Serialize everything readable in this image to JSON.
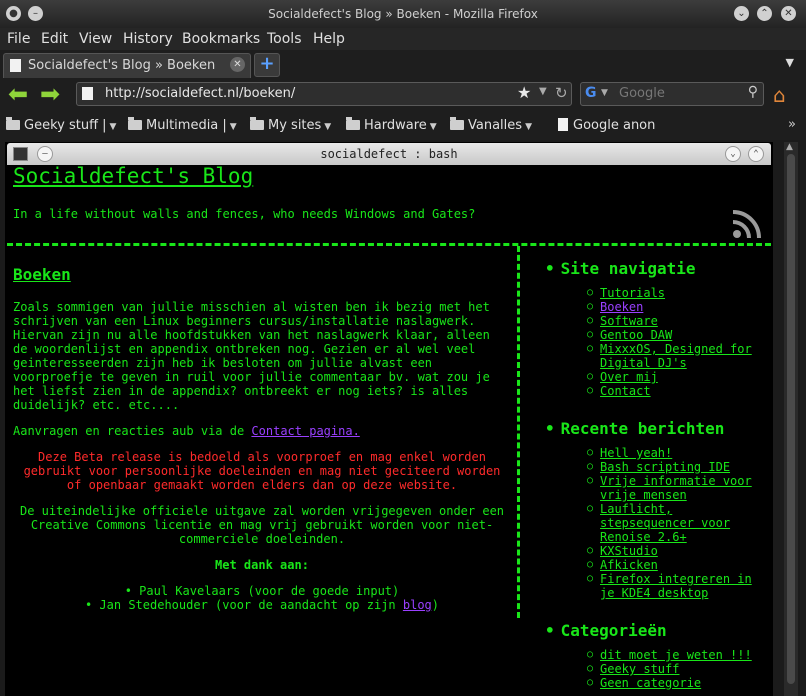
{
  "window": {
    "title": "Socialdefect's Blog » Boeken - Mozilla Firefox"
  },
  "menu": [
    "File",
    "Edit",
    "View",
    "History",
    "Bookmarks",
    "Tools",
    "Help"
  ],
  "tab": {
    "label": "Socialdefect's Blog » Boeken",
    "new_tab": "+"
  },
  "nav": {
    "url": "http://socialdefect.nl/boeken/",
    "search_placeholder": "Google"
  },
  "bookmarks": [
    "Geeky stuff |",
    "Multimedia |",
    "My sites",
    "Hardware",
    "Vanalles",
    "Google anon"
  ],
  "terminal": {
    "title": "socialdefect : bash"
  },
  "blog": {
    "title": "Socialdefect's Blog",
    "tagline": "In a life without walls and fences, who needs Windows and Gates?"
  },
  "content": {
    "heading": "Boeken",
    "intro": "Zoals sommigen van jullie misschien al wisten ben ik bezig met het schrijven van een Linux beginners cursus/installatie naslagwerk. Hiervan zijn nu alle hoofdstukken van het naslagwerk klaar, alleen de woordenlijst en appendix ontbreken nog. Gezien er al wel veel geinteresseerden zijn heb ik besloten om jullie alvast een voorproefje te geven in ruil voor jullie commentaar bv. wat zou je het liefst zien in de appendix? ontbreekt er nog iets? is alles duidelijk? etc. etc....",
    "request_prefix": "Aanvragen en reacties aub via de ",
    "request_link": "Contact pagina.",
    "beta_notice": "Deze Beta release is bedoeld als voorproef en mag enkel worden gebruikt voor persoonlijke doeleinden en mag niet geciteerd worden of  openbaar gemaakt worden elders dan op deze website.",
    "license": "De uiteindelijke officiele uitgave zal worden vrijgegeven onder een Creative Commons licentie en mag vrij gebruikt worden voor niet-commerciele doeleinden.",
    "thanks_heading": "Met dank aan:",
    "thanks_1": "• Paul Kavelaars (voor de goede input)",
    "thanks_2_prefix": "• Jan Stedehouder (voor de aandacht op zijn ",
    "thanks_2_link": "blog",
    "thanks_2_suffix": ")"
  },
  "sidebar": {
    "nav_heading": "Site navigatie",
    "nav_items": [
      "Tutorials",
      "Boeken",
      "Software",
      "Gentoo DAW",
      "MixxxOS, Designed for Digital DJ's",
      "Over mij",
      "Contact"
    ],
    "recent_heading": "Recente berichten",
    "recent_items": [
      "Hell yeah!",
      "Bash scripting IDE",
      "Vrije informatie voor vrije mensen",
      "Lauflicht, stepsequencer voor Renoise 2.6+",
      "KXStudio",
      "Afkicken",
      "Firefox integreren in je KDE4 desktop"
    ],
    "cat_heading": "Categorieën",
    "cat_items": [
      "dit moet je weten !!!",
      "Geeky stuff",
      "Geen categorie"
    ]
  },
  "colors": {
    "terminal_green": "#19e619",
    "visited_link": "#9a40ff",
    "warning_red": "#ff2b2b"
  }
}
